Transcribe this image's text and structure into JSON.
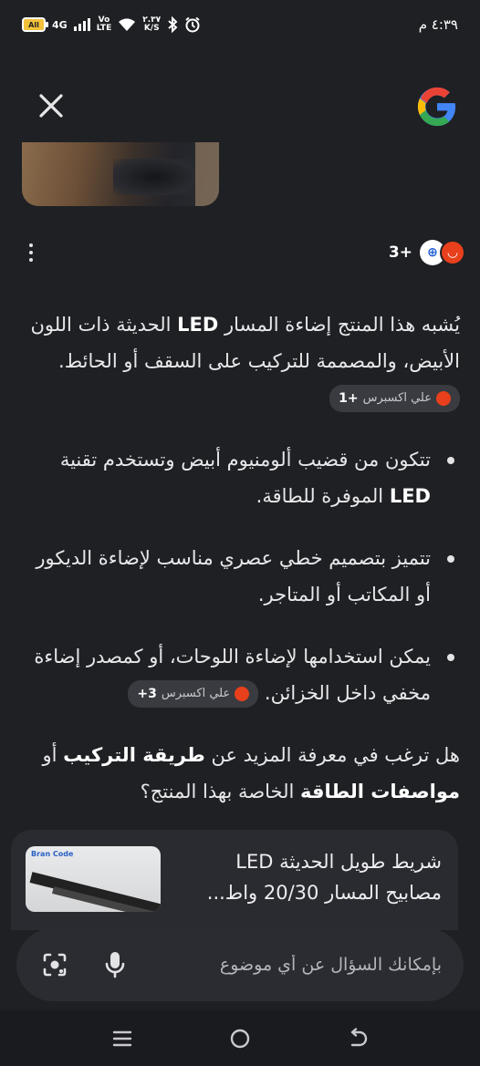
{
  "status_bar": {
    "battery": "All",
    "network": "4G",
    "volte_top": "Vo",
    "volte_bottom": "LTE",
    "speed_top": "٢.٣٧",
    "speed_bottom": "K/S",
    "time": "٤:٣٩ م"
  },
  "header": {
    "close_icon": "close-icon",
    "logo": "google-logo"
  },
  "sources": {
    "count": "3+",
    "icons": [
      "dinodirect-icon",
      "aliexpress-icon"
    ]
  },
  "answer": {
    "intro_1": "يُشبه هذا المنتج إضاءة المسار ",
    "intro_bold": "LED",
    "intro_2": " الحديثة ذات اللون الأبيض، والمصممة للتركيب على السقف أو الحائط.",
    "intro_chip": {
      "label": "علي اكسبرس",
      "count": "+1"
    },
    "bullets": [
      {
        "text_1": "تتكون من قضيب ألومنيوم أبيض وتستخدم تقنية ",
        "bold": "LED",
        "text_2": " الموفرة للطاقة."
      },
      {
        "text_1": "تتميز بتصميم خطي عصري مناسب لإضاءة الديكور أو المكاتب أو المتاجر.",
        "bold": "",
        "text_2": ""
      },
      {
        "text_1": "يمكن استخدامها لإضاءة اللوحات، أو كمصدر إضاءة مخفي داخل الخزائن.",
        "bold": "",
        "text_2": "",
        "chip": {
          "label": "علي اكسبرس",
          "count": "3+"
        }
      }
    ],
    "followup_1": "هل ترغب في معرفة المزيد عن ",
    "followup_bold_1": "طريقة التركيب",
    "followup_2": " أو ",
    "followup_bold_2": "مواصفات الطاقة",
    "followup_3": " الخاصة بهذا المنتج؟"
  },
  "result_card": {
    "title": "شريط طويل الحديثة LED مصابيح المسار 20/30 واط...",
    "image_brand": "Bran Code"
  },
  "input": {
    "placeholder": "بإمكانك السؤال عن أي موضوع"
  },
  "nav": {
    "buttons": [
      "recents-icon",
      "home-icon",
      "back-icon"
    ]
  },
  "colors": {
    "background": "#1f2024",
    "chip": "#3a3b40",
    "input_bar": "#2b2c31",
    "aliexpress": "#e8401c"
  }
}
